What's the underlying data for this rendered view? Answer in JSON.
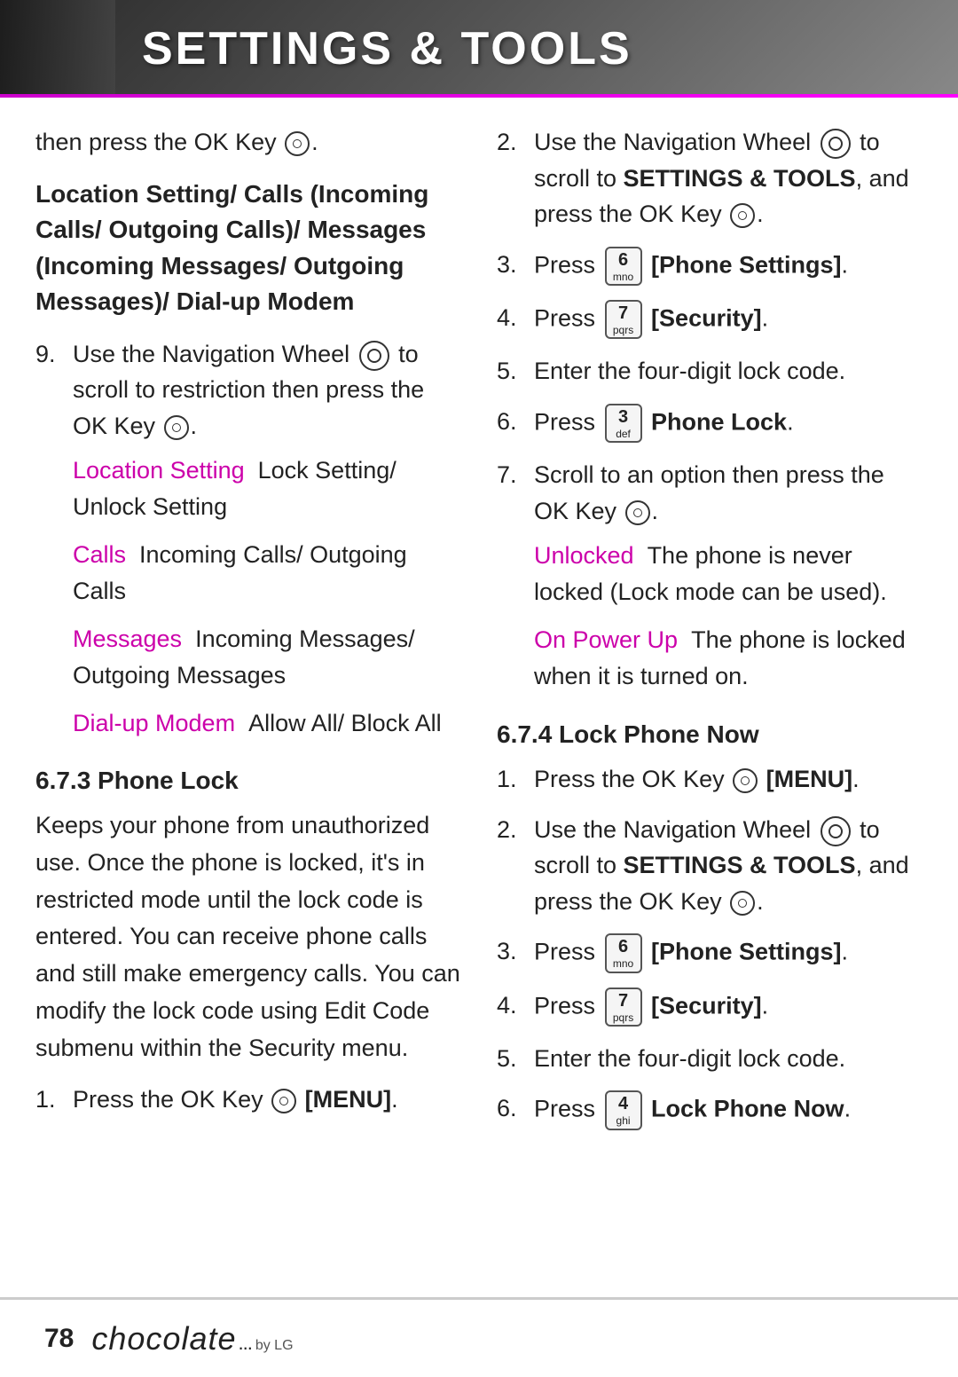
{
  "header": {
    "title": "SETTINGS & TOOLS"
  },
  "footer": {
    "page_number": "78",
    "brand": "chocolate",
    "dots": "...",
    "by_lg": "by LG"
  },
  "left_column": {
    "intro": "then press the OK Key ⊙.",
    "bold_section_title": "Location Setting/ Calls (Incoming Calls/ Outgoing Calls)/ Messages (Incoming Messages/ Outgoing Messages)/ Dial-up Modem",
    "item9": {
      "text_before": "Use the Navigation Wheel",
      "text_after": "to scroll to restriction then press the OK Key ⊙.",
      "sub_items": [
        {
          "label": "Location Setting",
          "desc": "Lock Setting/ Unlock Setting"
        },
        {
          "label": "Calls",
          "desc": "Incoming Calls/ Outgoing Calls"
        },
        {
          "label": "Messages",
          "desc": "Incoming Messages/ Outgoing Messages"
        },
        {
          "label": "Dial-up Modem",
          "desc": "Allow All/ Block All"
        }
      ]
    },
    "section_673": {
      "heading": "6.7.3 Phone Lock",
      "body": "Keeps your phone from unauthorized use. Once the phone is locked, it's in restricted mode until the lock code is entered. You can receive phone calls and still make emergency calls. You can modify the lock code using Edit Code submenu within the Security menu.",
      "item1": {
        "num": "1.",
        "text": "Press the OK Key ⊙ [MENU]."
      }
    }
  },
  "right_column": {
    "item2": {
      "num": "2.",
      "text_before": "Use the Navigation Wheel",
      "text_bold": "SETTINGS & TOOLS",
      "text_after": ", and press the OK Key ⊙."
    },
    "item3": {
      "num": "3.",
      "key_num": "6",
      "key_letters": "mno",
      "label": "Phone Settings"
    },
    "item4": {
      "num": "4.",
      "key_num": "7",
      "key_letters": "pqrs",
      "label": "Security"
    },
    "item5": {
      "num": "5.",
      "text": "Enter the four-digit lock code."
    },
    "item6": {
      "num": "6.",
      "key_num": "3",
      "key_letters": "def",
      "label": "Phone Lock"
    },
    "item7": {
      "num": "7.",
      "text": "Scroll to an option then press the OK Key ⊙.",
      "sub_items": [
        {
          "label": "Unlocked",
          "desc": "The phone is never locked (Lock mode can be used)."
        },
        {
          "label": "On Power Up",
          "desc": "The phone is locked when it is turned on."
        }
      ]
    },
    "section_674": {
      "heading": "6.7.4 Lock Phone Now",
      "item1": {
        "num": "1.",
        "text": "Press the OK Key ⊙ [MENU]."
      },
      "item2": {
        "num": "2.",
        "text_before": "Use the Navigation Wheel",
        "text_bold": "SETTINGS & TOOLS",
        "text_after": ", and press the OK Key ⊙."
      },
      "item3": {
        "num": "3.",
        "key_num": "6",
        "key_letters": "mno",
        "label": "Phone Settings"
      },
      "item4": {
        "num": "4.",
        "key_num": "7",
        "key_letters": "pqrs",
        "label": "Security"
      },
      "item5": {
        "num": "5.",
        "text": "Enter the four-digit lock code."
      },
      "item6": {
        "num": "6.",
        "key_num": "4",
        "key_letters": "ghi",
        "label": "Lock Phone Now"
      }
    }
  }
}
